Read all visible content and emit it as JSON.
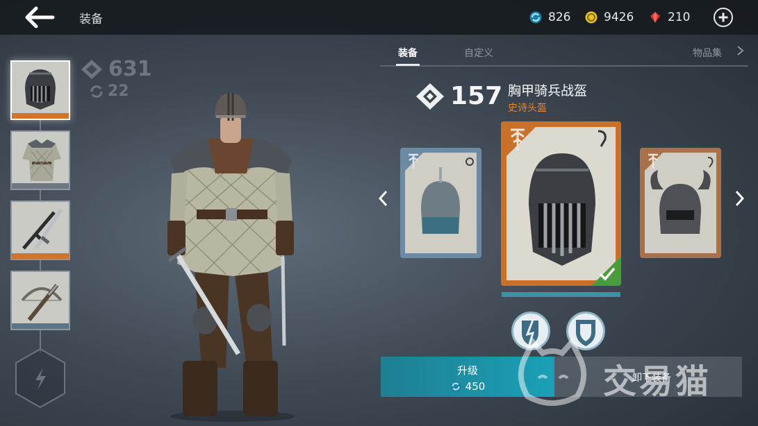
{
  "header": {
    "title": "装备",
    "currencies": [
      {
        "icon": "cyan-upgrade-token-icon",
        "value": "826",
        "color": "#38b6d8"
      },
      {
        "icon": "gold-coin-icon",
        "value": "9426",
        "color": "#e8c02a"
      },
      {
        "icon": "red-gem-icon",
        "value": "210",
        "color": "#d8322e"
      }
    ]
  },
  "character": {
    "power": "631",
    "upgrades": "22"
  },
  "equipment_slots": [
    {
      "name": "helmet",
      "rarity_color": "#d2732b",
      "selected": true
    },
    {
      "name": "armor",
      "rarity_color": "#6f7780",
      "selected": false
    },
    {
      "name": "weapons",
      "rarity_color": "#d2732b",
      "selected": false
    },
    {
      "name": "ranged",
      "rarity_color": "#5e7488",
      "selected": false
    }
  ],
  "tabs": [
    {
      "label": "装备",
      "active": true
    },
    {
      "label": "自定义",
      "active": false
    },
    {
      "label": "物品集",
      "active": false
    }
  ],
  "item": {
    "power": "157",
    "name": "胸甲骑兵战盔",
    "type": "史诗头盔"
  },
  "cards": [
    {
      "position": "left",
      "rarity_color": "#6d8aa4"
    },
    {
      "position": "center",
      "rarity_color": "#c9712a",
      "equipped": true
    },
    {
      "position": "right",
      "rarity_color": "#a9704c"
    }
  ],
  "actions": {
    "upgrade_label": "升级",
    "upgrade_cost": "450",
    "unequip_label": "卸下装备"
  },
  "colors": {
    "accent": "#1aa0b6",
    "epic": "#e7862e",
    "equipped": "#4a9a3e"
  },
  "watermark": "交易猫"
}
